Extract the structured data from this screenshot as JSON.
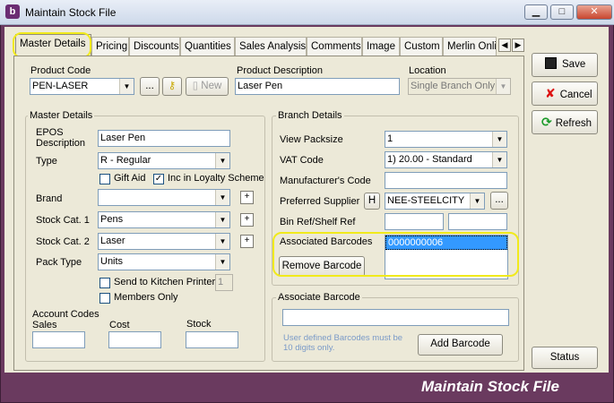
{
  "window": {
    "title": "Maintain Stock File",
    "footer_title": "Maintain Stock File",
    "app_icon_letter": "b"
  },
  "tabs": [
    "Master Details",
    "Pricing",
    "Discounts",
    "Quantities",
    "Sales Analysis",
    "Comments",
    "Image",
    "Custom",
    "Merlin Onlin"
  ],
  "header": {
    "product_code_label": "Product Code",
    "product_code_value": "PEN-LASER",
    "ellipsis_label": "...",
    "new_label": "New",
    "product_description_label": "Product Description",
    "product_description_value": "Laser Pen",
    "location_label": "Location",
    "location_value": "Single Branch Only"
  },
  "master_details": {
    "group_label": "Master Details",
    "epos_label": "EPOS\nDescription",
    "epos_value": "Laser Pen",
    "type_label": "Type",
    "type_value": "R - Regular",
    "gift_aid_label": "Gift Aid",
    "gift_aid_checked": false,
    "loyalty_label": "Inc in Loyalty Scheme",
    "loyalty_checked": true,
    "brand_label": "Brand",
    "brand_value": "",
    "stock_cat1_label": "Stock Cat. 1",
    "stock_cat1_value": "Pens",
    "stock_cat2_label": "Stock Cat. 2",
    "stock_cat2_value": "Laser",
    "pack_type_label": "Pack Type",
    "pack_type_value": "Units",
    "kitchen_label": "Send to Kitchen Printer",
    "kitchen_checked": false,
    "kitchen_value": "1",
    "members_label": "Members Only",
    "members_checked": false,
    "account_codes_label": "Account Codes",
    "sales_label": "Sales",
    "cost_label": "Cost",
    "stock_label": "Stock",
    "add_symbol": "+"
  },
  "branch_details": {
    "group_label": "Branch Details",
    "view_packsize_label": "View Packsize",
    "view_packsize_value": "1",
    "vat_code_label": "VAT Code",
    "vat_code_value": "1) 20.00 - Standard",
    "manufacturer_label": "Manufacturer's Code",
    "manufacturer_value": "",
    "preferred_supplier_label": "Preferred Supplier",
    "h_label": "H",
    "preferred_supplier_value": "NEE-STEELCITY",
    "supplier_ellipsis": "...",
    "bin_ref_label": "Bin Ref/Shelf Ref",
    "associated_barcodes_label": "Associated Barcodes",
    "barcodes": [
      "0000000006"
    ],
    "remove_barcode_label": "Remove Barcode"
  },
  "associate_barcode": {
    "group_label": "Associate Barcode",
    "input_value": "",
    "hint": "User defined Barcodes must be 10 digits only.",
    "add_barcode_label": "Add Barcode"
  },
  "side_buttons": {
    "save": "Save",
    "cancel": "Cancel",
    "refresh": "Refresh",
    "status": "Status"
  },
  "colors": {
    "window_frame": "#6a3a5f",
    "highlight": "#f1ea1c",
    "selection": "#3399ff"
  }
}
